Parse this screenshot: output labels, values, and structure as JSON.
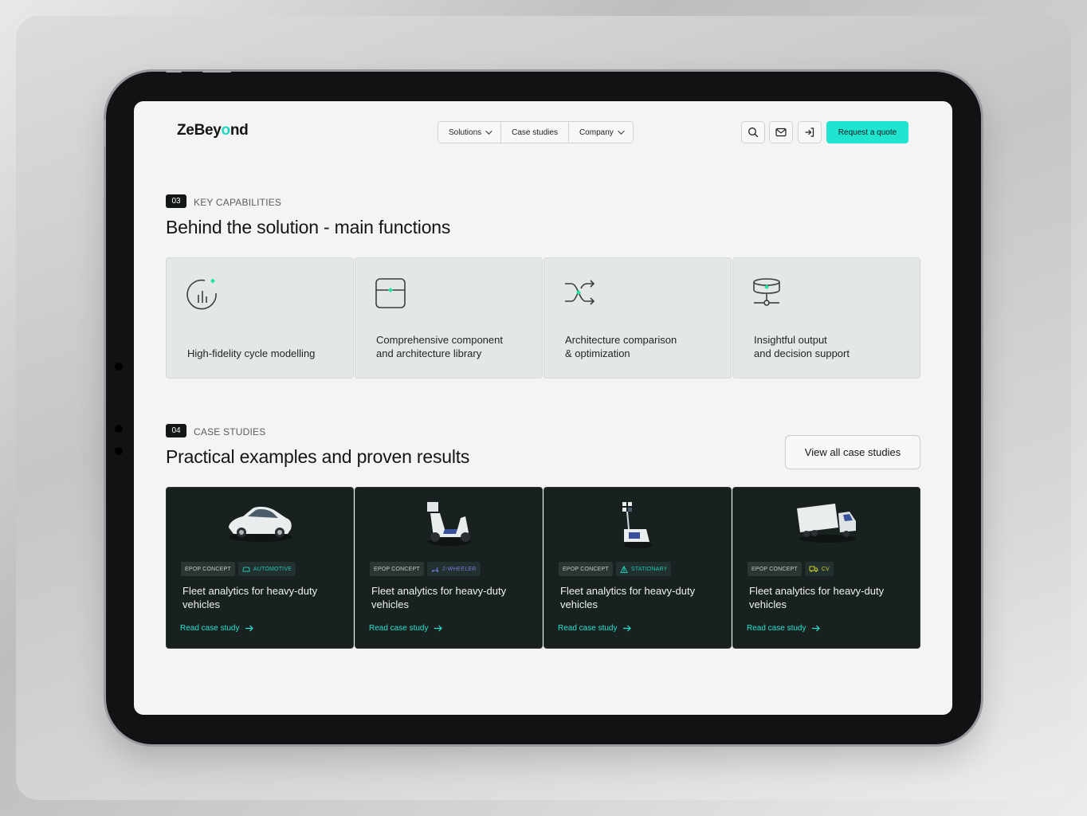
{
  "brand": {
    "logo_pre": "ZeBey",
    "logo_o": "o",
    "logo_post": "nd",
    "accent": "#20e3d0"
  },
  "nav": {
    "items": [
      {
        "label": "Solutions",
        "has_dropdown": true
      },
      {
        "label": "Case studies",
        "has_dropdown": false
      },
      {
        "label": "Company",
        "has_dropdown": true
      }
    ],
    "icons": [
      "search-icon",
      "mail-icon",
      "login-icon"
    ],
    "cta_label": "Request a quote"
  },
  "capabilities": {
    "badge": "03",
    "eyebrow": "KEY CAPABILITIES",
    "heading": "Behind the solution - main functions",
    "items": [
      {
        "icon": "cycle-chart-icon",
        "label": "High-fidelity cycle modelling"
      },
      {
        "icon": "component-library-icon",
        "label": "Comprehensive component\nand architecture library"
      },
      {
        "icon": "shuffle-compare-icon",
        "label": "Architecture comparison\n& optimization"
      },
      {
        "icon": "database-output-icon",
        "label": "Insightful output\nand decision support"
      }
    ]
  },
  "case_studies": {
    "badge": "04",
    "eyebrow": "CASE STUDIES",
    "heading": "Practical examples and proven results",
    "view_all_label": "View all case studies",
    "items": [
      {
        "image": "car-illustration",
        "tag1": "EPOP CONCEPT",
        "tag2": "AUTOMOTIVE",
        "tag2_icon": "car-icon",
        "tag2_color": "#1fc6b2",
        "title": "Fleet analytics for heavy-duty vehicles",
        "link": "Read case study"
      },
      {
        "image": "scooter-illustration",
        "tag1": "EPOP CONCEPT",
        "tag2": "2-WHEELER",
        "tag2_icon": "scooter-icon",
        "tag2_color": "#6f7bd8",
        "title": "Fleet analytics for heavy-duty vehicles",
        "link": "Read case study"
      },
      {
        "image": "light-tower-illustration",
        "tag1": "EPOP CONCEPT",
        "tag2": "STATIONARY",
        "tag2_icon": "tower-icon",
        "tag2_color": "#1fc6b2",
        "title": "Fleet analytics for heavy-duty vehicles",
        "link": "Read case study"
      },
      {
        "image": "truck-illustration",
        "tag1": "EPOP CONCEPT",
        "tag2": "CV",
        "tag2_icon": "truck-icon",
        "tag2_color": "#c9d22a",
        "title": "Fleet analytics for heavy-duty vehicles",
        "link": "Read case study"
      }
    ]
  }
}
